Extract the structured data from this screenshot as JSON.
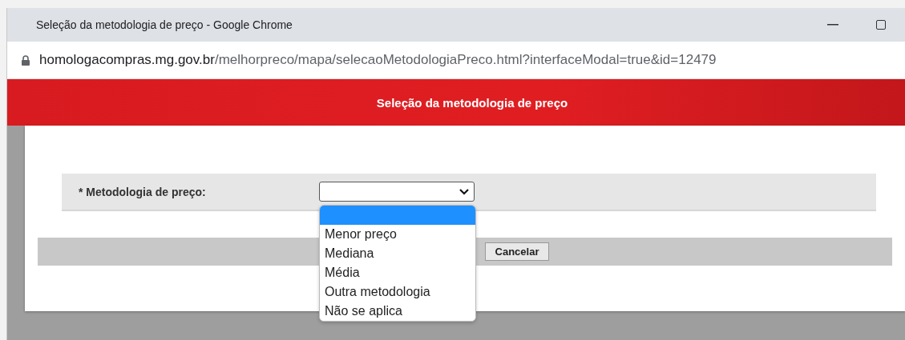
{
  "window": {
    "title": "Seleção da metodologia de preço - Google Chrome"
  },
  "address_bar": {
    "host": "homologacompras.mg.gov.br",
    "path": "/melhorpreco/mapa/selecaoMetodologiaPreco.html?interfaceModal=true&id=12479"
  },
  "header": {
    "title": "Seleção da metodologia de preço"
  },
  "form": {
    "label": "* Metodologia de preço:",
    "select": {
      "open": true,
      "blank_selected": true,
      "options": [
        {
          "label": "Menor preço",
          "selected": false
        },
        {
          "label": "Mediana",
          "selected": false
        },
        {
          "label": "Média",
          "selected": false
        },
        {
          "label": "Outra metodologia",
          "selected": false
        },
        {
          "label": "Não se aplica",
          "selected": false
        }
      ]
    }
  },
  "buttons": [
    {
      "label": "Cancelar"
    }
  ]
}
